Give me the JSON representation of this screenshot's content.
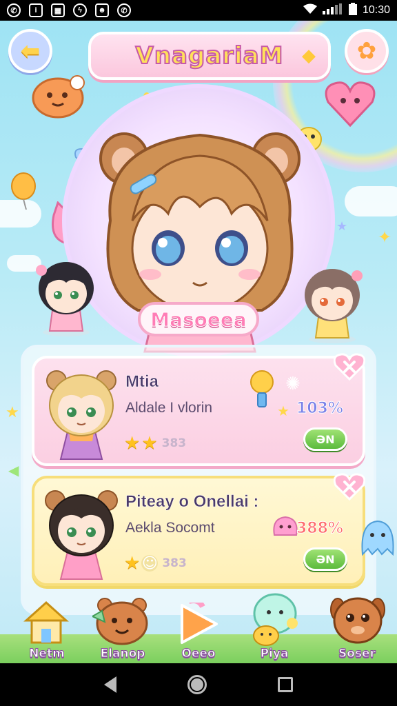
{
  "status_bar": {
    "time": "10:30",
    "left_icons": [
      "whatsapp-icon",
      "info-icon",
      "image-icon",
      "messenger-icon",
      "discord-icon",
      "whatsapp-icon"
    ],
    "right_icons": [
      "wifi-icon",
      "signal-icon",
      "battery-icon"
    ]
  },
  "header": {
    "title": "VnagariaM"
  },
  "hero": {
    "name": "Masoeea"
  },
  "cards": [
    {
      "title": "Mtia",
      "subtitle": "Aldale I vlorin",
      "stars": 2,
      "count": "383",
      "percent": "103%",
      "button": "ƏN"
    },
    {
      "title": "Piteay o Onellai :",
      "subtitle": "Aekla Socomt",
      "stars": 1,
      "count": "383",
      "percent": "388%",
      "button": "ƏN"
    }
  ],
  "bottom_nav": [
    {
      "label": "Netm"
    },
    {
      "label": "Elanop"
    },
    {
      "label": "Oeeo"
    },
    {
      "label": "Piya"
    },
    {
      "label": "Soser"
    }
  ],
  "colors": {
    "sky": "#9fe3f4",
    "pink": "#fbcfe2",
    "yellow": "#fff0b8",
    "green_button": "#5cbb3d"
  }
}
